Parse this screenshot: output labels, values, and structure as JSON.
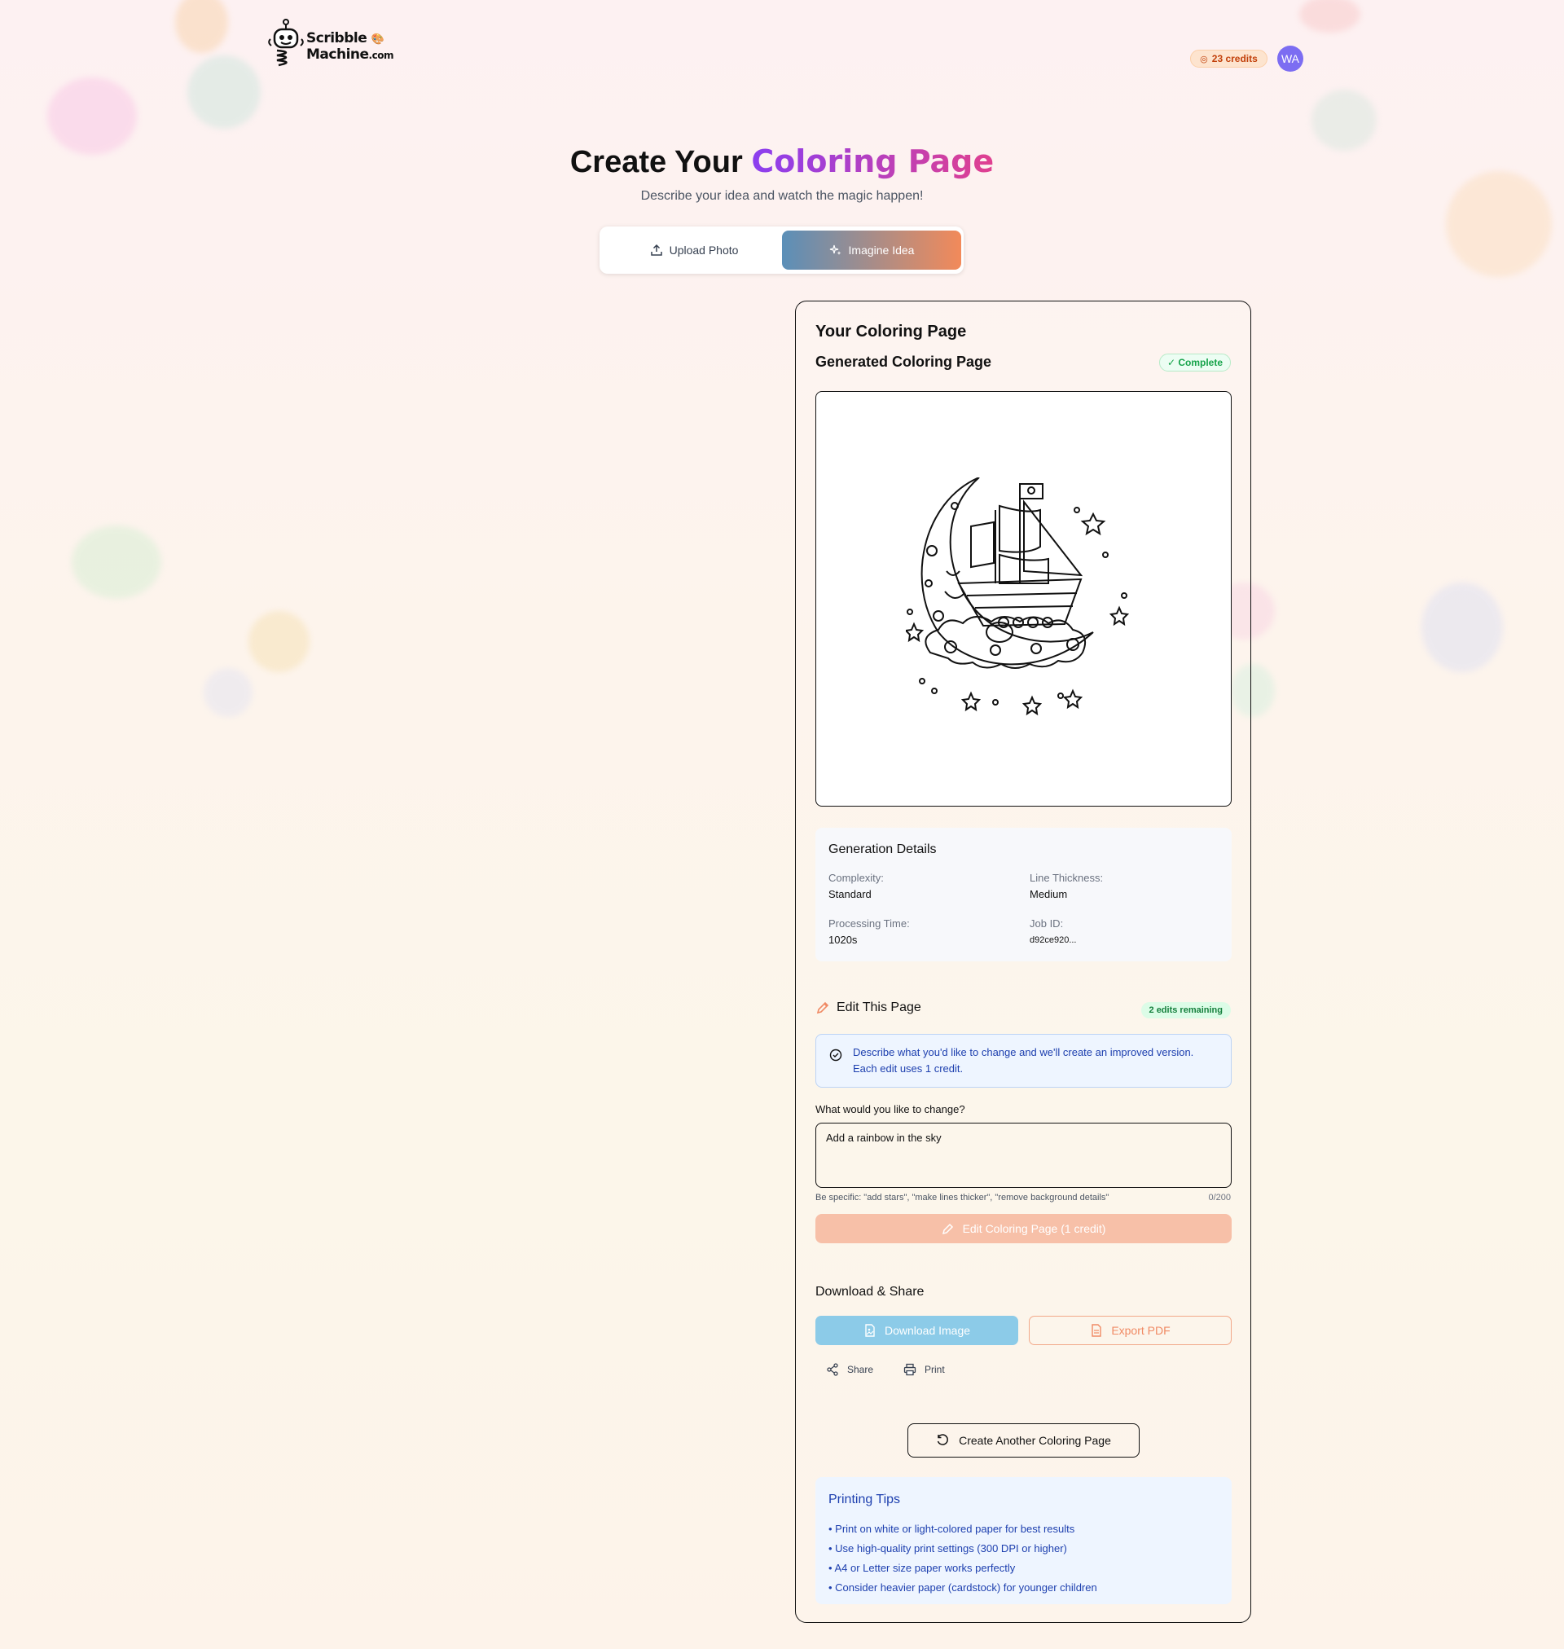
{
  "header": {
    "logo_line1": "Scribble",
    "logo_line2": "Machine",
    "logo_suffix": ".com",
    "credits": "23 credits",
    "avatar_initials": "WA"
  },
  "hero": {
    "title_plain": "Create Your",
    "title_highlight": "Coloring Page",
    "subtitle": "Describe your idea and watch the magic happen!"
  },
  "mode_switch": {
    "upload_label": "Upload Photo",
    "imagine_label": "Imagine Idea",
    "selected": "Imagine Idea"
  },
  "result": {
    "title": "Your Coloring Page",
    "subtitle": "Generated Coloring Page",
    "status": "✓ Complete"
  },
  "details": {
    "heading": "Generation Details",
    "complexity_label": "Complexity:",
    "complexity_value": "Standard",
    "line_thickness_label": "Line Thickness:",
    "line_thickness_value": "Medium",
    "processing_label": "Processing Time:",
    "processing_value": "1020s",
    "job_label": "Job ID:",
    "job_value": "d92ce920..."
  },
  "edit": {
    "heading": "Edit This Page",
    "remaining": "2 edits remaining",
    "info": "Describe what you'd like to change and we'll create an improved version. Each edit uses 1 credit.",
    "field_label": "What would you like to change?",
    "field_value": "Add a rainbow in the sky",
    "hint": "Be specific: \"add stars\", \"make lines thicker\", \"remove background details\"",
    "counter": "0/200",
    "button": "Edit Coloring Page (1 credit)"
  },
  "download": {
    "heading": "Download & Share",
    "download_image": "Download Image",
    "export_pdf": "Export PDF",
    "share": "Share",
    "print": "Print"
  },
  "create_another": "Create Another Coloring Page",
  "tips": {
    "heading": "Printing Tips",
    "items": [
      "• Print on white or light-colored paper for best results",
      "• Use high-quality print settings (300 DPI or higher)",
      "• A4 or Letter size paper works perfectly",
      "• Consider heavier paper (cardstock) for younger children"
    ]
  },
  "colors": {
    "accent_gradient_start": "#5b8fb8",
    "accent_gradient_end": "#f28a5a",
    "title_gradient_start": "#8b3ff0",
    "title_gradient_end": "#e0408f",
    "success": "#16a34a",
    "info": "#1e40af"
  },
  "icons": {
    "upload": "upload-icon",
    "imagine": "sparkles-icon",
    "edit": "pencil-icon",
    "info": "check-circle-icon",
    "download": "image-file-icon",
    "pdf": "file-text-icon",
    "share": "share-icon",
    "print": "printer-icon",
    "refresh": "refresh-icon",
    "credits": "coin-icon"
  }
}
